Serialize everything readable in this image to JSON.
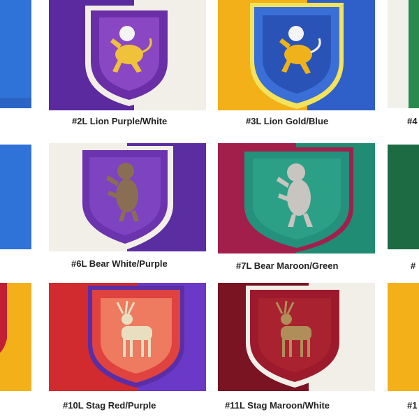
{
  "captions": {
    "c2": "#2L Lion Purple/White",
    "c3": "#3L Lion Gold/Blue",
    "c4": "#4",
    "c6": "#6L Bear White/Purple",
    "c7": "#7L Bear Maroon/Green",
    "c8": "#",
    "c10": "#10L Stag Red/Purple",
    "c11": "#11L Stag Maroon/White",
    "c12": "#1"
  },
  "colors": {
    "purple": "#5b2a9e",
    "white": "#f2efe9",
    "gold": "#f3b019",
    "blue": "#2f5fc8",
    "maroon": "#8a1c3a",
    "green": "#1f8c73",
    "red": "#d12a2f",
    "dark_maroon": "#7a1322"
  }
}
